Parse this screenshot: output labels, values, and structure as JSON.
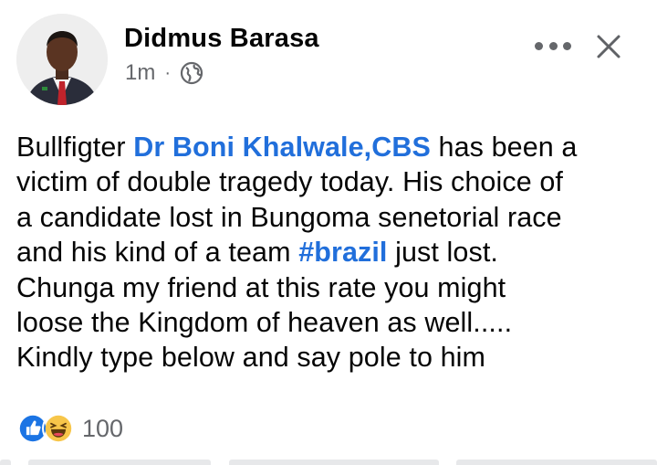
{
  "post": {
    "author": "Didmus Barasa",
    "time": "1m",
    "separator": "·",
    "audience_icon": "globe-icon",
    "lines": [
      {
        "before": "Bullfigter ",
        "link": "Dr Boni Khalwale,CBS",
        "after": " has been a"
      },
      {
        "text": "victim of double tragedy today. His choice of"
      },
      {
        "text": "a candidate lost in Bungoma senetorial race"
      },
      {
        "before": "and his kind of a team ",
        "link": "#brazil",
        "after": " just lost."
      },
      {
        "text": "Chunga my friend at this rate you might"
      },
      {
        "text": "loose the Kingdom of heaven as well....."
      },
      {
        "text": "Kindly type below and say pole to him"
      }
    ]
  },
  "reactions": {
    "icons": [
      "like-icon",
      "haha-icon"
    ],
    "count": "100"
  },
  "colors": {
    "link": "#216fdb",
    "secondary_text": "#65676b",
    "like_blue": "#1b74e4",
    "haha_yellow": "#f7c64a"
  }
}
